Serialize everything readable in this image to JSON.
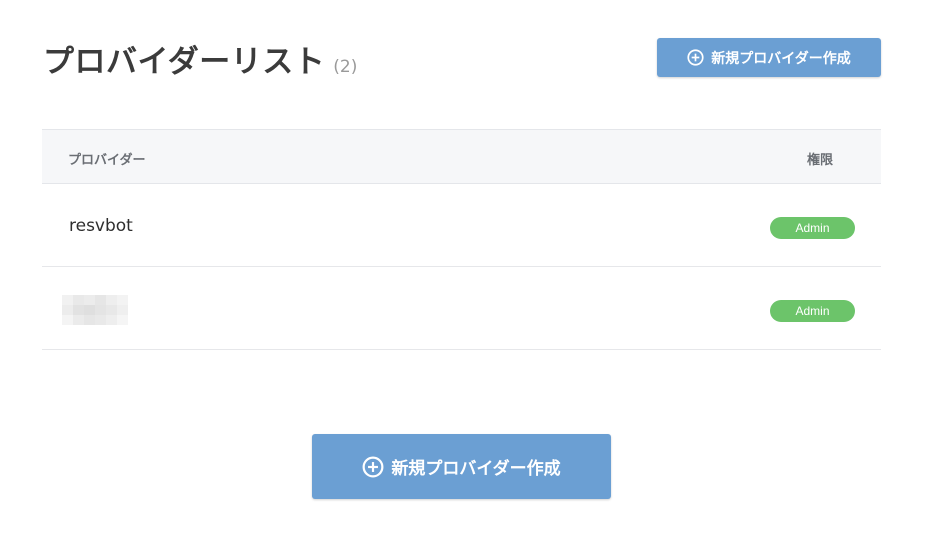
{
  "header": {
    "title": "プロバイダーリスト",
    "count": "(2)"
  },
  "actions": {
    "create_label": "新規プロバイダー作成",
    "create_icon": "plus-circle-icon"
  },
  "table": {
    "columns": {
      "provider": "プロバイダー",
      "role": "権限"
    },
    "rows": [
      {
        "name": "resvbot",
        "role": "Admin"
      },
      {
        "name": "",
        "role": "Admin"
      }
    ]
  },
  "colors": {
    "primary_button": "#6b9fd3",
    "admin_badge": "#6cc46a",
    "header_bg": "#f6f7f9"
  }
}
